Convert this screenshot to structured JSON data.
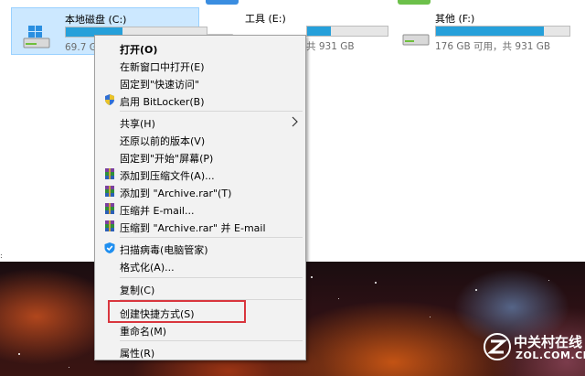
{
  "drives": [
    {
      "name": "本地磁盘 (C:)",
      "free_text": "69.7 GB 可用，共 ...",
      "used_fraction": 0.4,
      "selected": true
    },
    {
      "name": "工具 (E:)",
      "free_text": "共 931 GB",
      "used_fraction": 0.3,
      "selected": false
    },
    {
      "name": "其他 (F:)",
      "free_text": "176 GB 可用，共 931 GB",
      "used_fraction": 0.81,
      "selected": false
    }
  ],
  "context_menu": {
    "items": {
      "open": "打开(O)",
      "open_new_window": "在新窗口中打开(E)",
      "pin_quick_access": "固定到\"快速访问\"",
      "enable_bitlocker": "启用 BitLocker(B)",
      "share": "共享(H)",
      "restore_previous": "还原以前的版本(V)",
      "pin_start": "固定到\"开始\"屏幕(P)",
      "add_to_archive": "添加到压缩文件(A)...",
      "add_to_archive_rar": "添加到 \"Archive.rar\"(T)",
      "compress_email": "压缩并 E-mail...",
      "compress_rar_email": "压缩到 \"Archive.rar\" 并 E-mail",
      "scan_virus": "扫描病毒(电脑管家)",
      "format": "格式化(A)...",
      "copy": "复制(C)",
      "create_shortcut": "创建快捷方式(S)",
      "rename": "重命名(M)",
      "properties": "属性(R)"
    },
    "highlighted_item": "create_shortcut"
  },
  "watermark": {
    "cn": "中关村在线",
    "en": "ZOL.COM.CN"
  },
  "icons": [
    "windows-drive-icon",
    "hard-drive-icon",
    "shield-icon",
    "winrar-icon",
    "tencent-guard-icon",
    "chevron-right-icon"
  ],
  "colors": {
    "selection": "#cce8ff",
    "bar_fill": "#26a0da",
    "highlight_border": "#d9363e",
    "menu_bg": "#f2f2f2"
  }
}
